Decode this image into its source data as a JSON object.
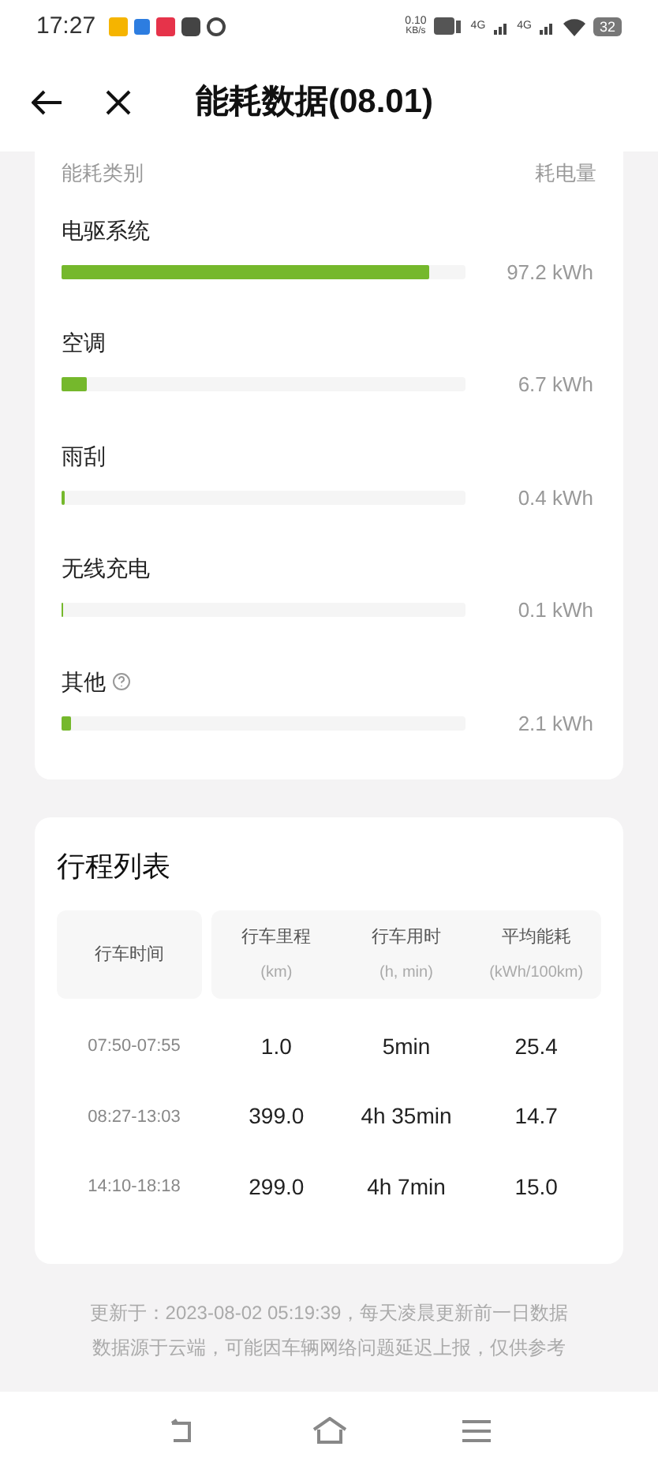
{
  "status_bar": {
    "time": "17:27",
    "net_speed": "0.10",
    "net_unit": "KB/s",
    "sim1": "4G",
    "sim2": "4G",
    "battery": "32"
  },
  "header": {
    "title": "能耗数据(08.01)"
  },
  "energy": {
    "category_header": "能耗类别",
    "amount_header": "耗电量",
    "items": [
      {
        "name": "电驱系统",
        "value": "97.2 kWh",
        "level": 0.91,
        "help": false
      },
      {
        "name": "空调",
        "value": "6.7 kWh",
        "level": 0.063,
        "help": false
      },
      {
        "name": "雨刮",
        "value": "0.4 kWh",
        "level": 0.006,
        "help": false
      },
      {
        "name": "无线充电",
        "value": "0.1 kWh",
        "level": 0.003,
        "help": false
      },
      {
        "name": "其他",
        "value": "2.1 kWh",
        "level": 0.023,
        "help": true
      }
    ]
  },
  "trips": {
    "title": "行程列表",
    "columns": [
      {
        "label": "行车时间"
      },
      {
        "label": "行车里程",
        "unit": "(km)"
      },
      {
        "label": "行车用时",
        "unit": "(h, min)"
      },
      {
        "label": "平均能耗",
        "unit": "(kWh/100km)"
      }
    ],
    "rows": [
      [
        "07:50-07:55",
        "1.0",
        "5min",
        "25.4"
      ],
      [
        "08:27-13:03",
        "399.0",
        "4h 35min",
        "14.7"
      ],
      [
        "14:10-18:18",
        "299.0",
        "4h 7min",
        "15.0"
      ]
    ]
  },
  "footer": [
    "更新于：2023-08-02 05:19:39，每天凌晨更新前一日数据",
    "数据源于云端，可能因车辆网络问题延迟上报，仅供参考"
  ]
}
